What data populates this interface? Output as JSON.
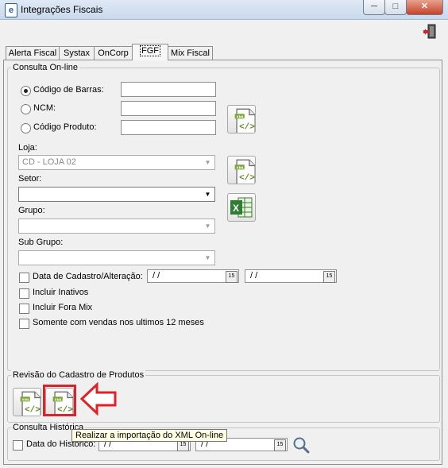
{
  "window": {
    "title": "Integrações Fiscais",
    "buttons": [
      "─",
      "□",
      "✕"
    ],
    "app_icon": "e"
  },
  "tabs": [
    "Alerta Fiscal",
    "Systax",
    "OnCorp",
    "FGF",
    "Mix Fiscal"
  ],
  "active_tab": "FGF",
  "consulta_online": {
    "legend": "Consulta On-line",
    "options": [
      {
        "label": "Código de Barras:",
        "selected": true,
        "value": ""
      },
      {
        "label": "NCM:",
        "selected": false,
        "value": ""
      },
      {
        "label": "Código Produto:",
        "selected": false,
        "value": ""
      }
    ],
    "loja": {
      "label": "Loja:",
      "value": "CD - LOJA 02"
    },
    "setor": {
      "label": "Setor:",
      "value": ""
    },
    "grupo": {
      "label": "Grupo:",
      "value": ""
    },
    "subgrupo": {
      "label": "Sub Grupo:",
      "value": ""
    },
    "data_cadastro": {
      "label": "Data de Cadastro/Alteração:",
      "from": "/  /",
      "to": "/  /"
    },
    "checks": [
      "Incluir Inativos",
      "Incluir Fora Mix",
      "Somente com vendas nos ultimos 12 meses"
    ]
  },
  "revisao": {
    "legend": "Revisão do Cadastro de Produtos"
  },
  "tooltip": "Realizar a importação do XML On-line",
  "consulta_historica": {
    "legend": "Consulta Histórica",
    "data_label": "Data do Historico:",
    "from": "/  /",
    "to": "/  /"
  },
  "icons": {
    "toolbar": "exit-door-icon",
    "xml": "xml-file-icon",
    "excel": "excel-icon",
    "search": "magnifier-icon",
    "calendar": "calendar-icon"
  },
  "colors": {
    "highlight_red": "#e2202a",
    "tooltip_bg": "#ffffe1",
    "xml_green": "#6a9a2a"
  }
}
